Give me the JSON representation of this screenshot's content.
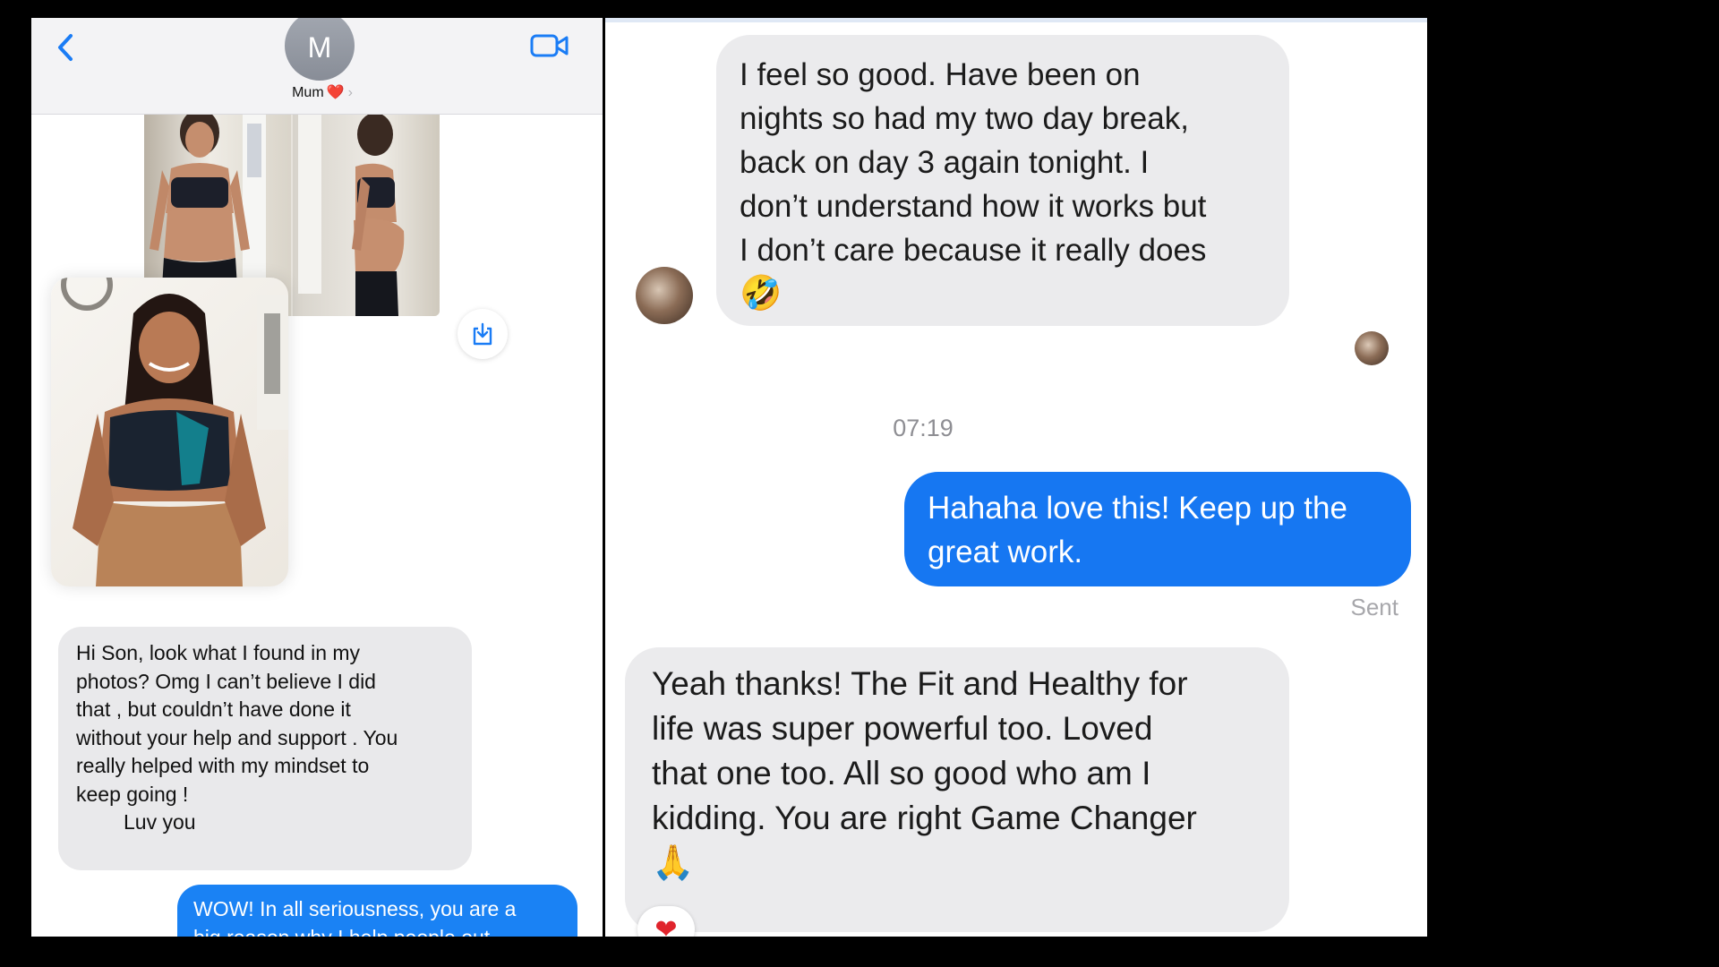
{
  "left": {
    "header": {
      "avatar_initial": "M",
      "contact_name": "Mum",
      "contact_emoji": "❤️",
      "chevron": "›",
      "back_icon": "chevron-left-icon",
      "video_icon": "video-camera-icon"
    },
    "save_icon": "download-icon",
    "messages": [
      {
        "from": "Mum",
        "lines": [
          "Hi Son, look what I found in my",
          "photos? Omg I can’t believe I did",
          "that , but couldn’t have done it",
          "without your help and support . You",
          "really helped with my mindset to",
          "keep going !"
        ],
        "signoff": "Luv you"
      },
      {
        "from": "me",
        "lines": [
          "WOW! In all seriousness, you are a",
          "big reason why I help people out"
        ]
      }
    ]
  },
  "right": {
    "messages": [
      {
        "from": "them",
        "lines": [
          "I feel so good. Have been on",
          "nights so had my two day break,",
          "back on day 3 again tonight. I",
          "don’t understand how it works but",
          "I don’t care because it really does"
        ],
        "emoji": "🤣"
      },
      {
        "type": "timestamp",
        "text": "07:19"
      },
      {
        "from": "me",
        "lines": [
          "Hahaha love this! Keep up the",
          "great work."
        ],
        "status": "Sent"
      },
      {
        "from": "them",
        "lines": [
          "Yeah thanks! The Fit and Healthy for",
          "life was super powerful too. Loved",
          "that one too. All so good who am I",
          "kidding. You are right Game Changer"
        ],
        "emoji": "🙏",
        "reaction": "❤"
      }
    ]
  },
  "colors": {
    "imessage_blue": "#1a82f4",
    "messenger_blue": "#1677f2",
    "bubble_grey": "#e9e9eb",
    "reaction_red": "#e0242c"
  }
}
